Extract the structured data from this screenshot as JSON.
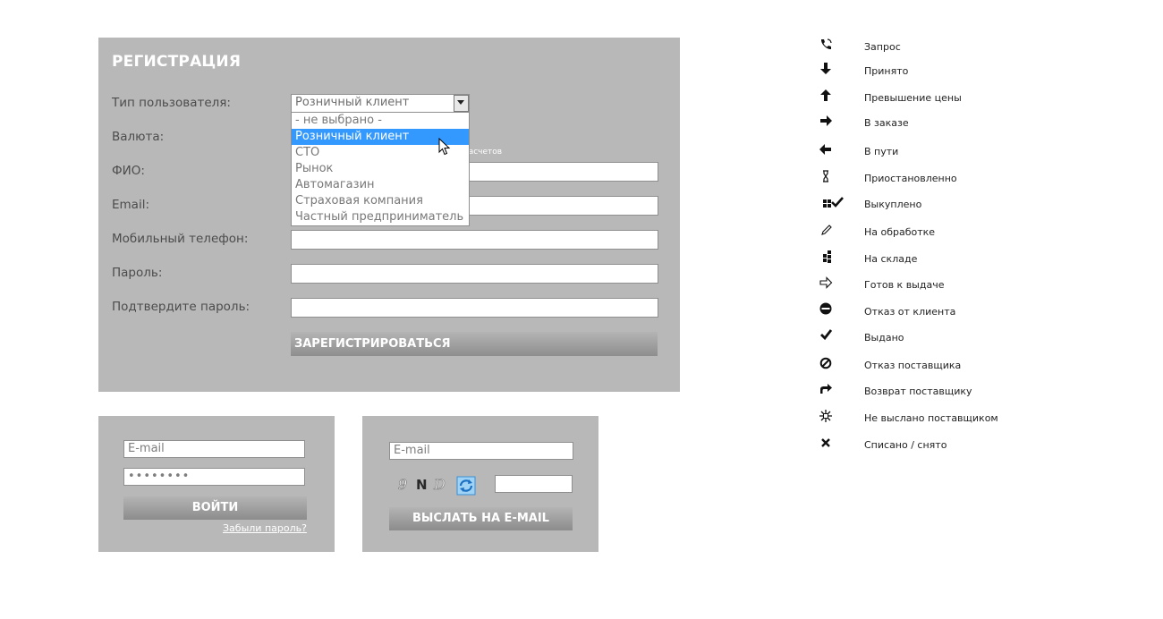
{
  "registration": {
    "title": "РЕГИСТРАЦИЯ",
    "labels": {
      "user_type": "Тип пользователя:",
      "currency": "Валюта:",
      "full_name": "ФИО:",
      "email": "Email:",
      "mobile": "Мобильный телефон:",
      "password": "Пароль:",
      "confirm_password": "Подтвердите пароль:"
    },
    "user_type_value": "Розничный клиент",
    "user_type_options": [
      "- не выбрано -",
      "Розничный клиент",
      "СТО",
      "Рынок",
      "Автомагазин",
      "Страховая компания",
      "Частный предприниматель"
    ],
    "selected_option": "Розничный клиент",
    "currency_hint_text": "расчетов",
    "submit_label": "ЗАРЕГИСТРИРОВАТЬСЯ"
  },
  "login": {
    "email_placeholder": "E-mail",
    "password_value": "••••••••",
    "submit_label": "ВОЙТИ",
    "forgot_link": "Забыли пароль?"
  },
  "recovery": {
    "email_placeholder": "E-mail",
    "captcha_chars": [
      "9",
      "N",
      "D"
    ],
    "submit_label": "ВЫСЛАТЬ НА E-MAIL"
  },
  "legend": [
    {
      "icon": "phone-icon",
      "label": "Запрос"
    },
    {
      "icon": "arrow-down-icon",
      "label": "Принято"
    },
    {
      "icon": "arrow-up-icon",
      "label": "Превышение цены"
    },
    {
      "icon": "arrow-right-icon",
      "label": "В заказе"
    },
    {
      "icon": "arrow-left-icon",
      "label": "В пути"
    },
    {
      "icon": "hourglass-icon",
      "label": "Приостановленно"
    },
    {
      "icon": "grid-check-icon",
      "label": "Выкуплено"
    },
    {
      "icon": "pencil-icon",
      "label": "На обработке"
    },
    {
      "icon": "warehouse-grid-icon",
      "label": "На складе"
    },
    {
      "icon": "outline-arrow-right-icon",
      "label": "Готов к выдаче"
    },
    {
      "icon": "minus-circle-icon",
      "label": "Отказ от клиента"
    },
    {
      "icon": "check-icon",
      "label": "Выдано"
    },
    {
      "icon": "forbidden-icon",
      "label": "Отказ поставщика"
    },
    {
      "icon": "share-arrow-icon",
      "label": "Возврат поставщику"
    },
    {
      "icon": "burst-icon",
      "label": "Не выслано поставщиком"
    },
    {
      "icon": "cross-icon",
      "label": "Списано / снято"
    }
  ],
  "colors": {
    "panel_bg": "#b8b8b8",
    "selected_option_bg": "#3399ff",
    "button_gradient_top": "#b4b4b4",
    "button_gradient_bottom": "#8e8e8e"
  }
}
